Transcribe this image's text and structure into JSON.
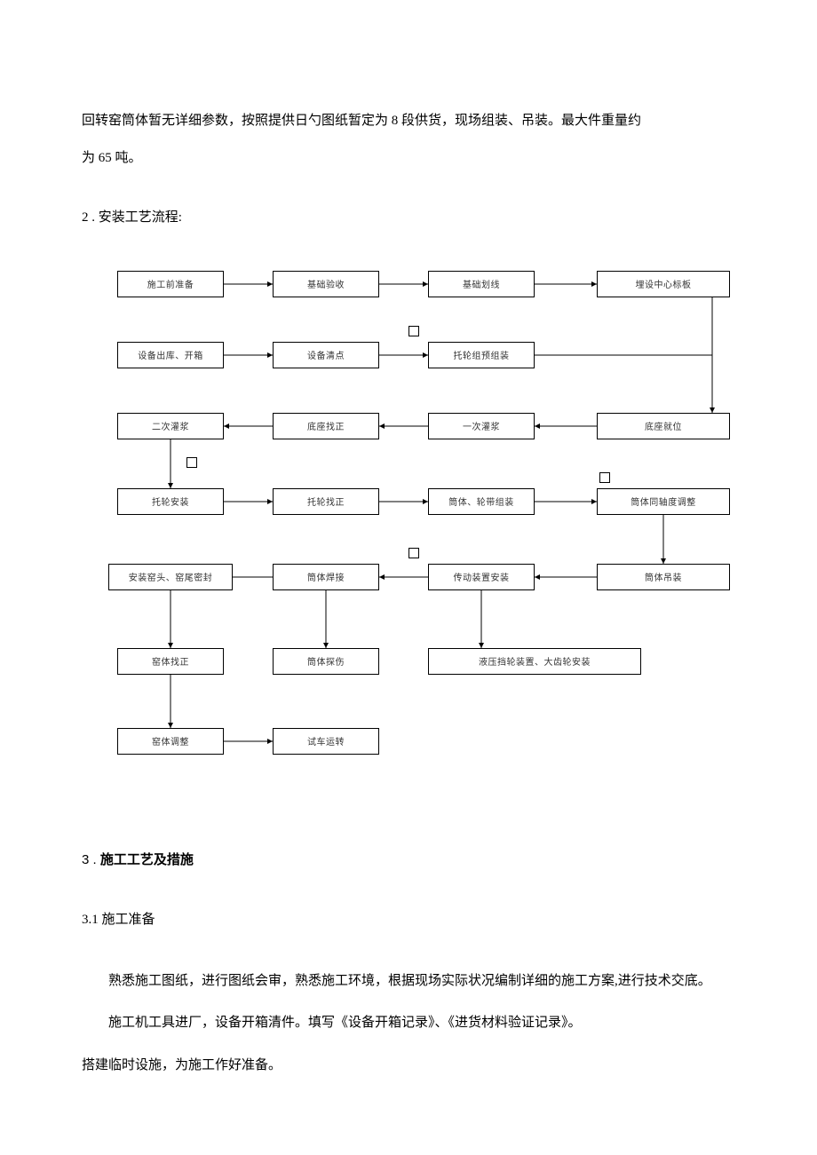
{
  "p1": "回转窑筒体暂无详细参数，按照提供日勺图纸暂定为 8 段供货，现场组装、吊装。最大件重量约",
  "p2": "为 65 吨。",
  "s2": "2 . 安装工艺流程:",
  "s3_prefix": "3 . ",
  "s3_title": "施工工艺及措施",
  "s31": "3.1 施工准备",
  "b1": "熟悉施工图纸，进行图纸会审，熟悉施工环境，根据现场实际状况编制详细的施工方案,进行技术交底。",
  "b2": "施工机工具进厂，设备开箱清件。填写《设备开箱记录》、《进货材料验证记录》。",
  "b3": "搭建临时设施，为施工作好准备。",
  "flow": {
    "r1": {
      "a": "施工前准备",
      "b": "基础验收",
      "c": "基础划线",
      "d": "埋设中心标板"
    },
    "r2": {
      "a": "设备出库、开箱",
      "b": "设备清点",
      "c": "托轮组预组装"
    },
    "r3": {
      "a": "二次灌浆",
      "b": "底座找正",
      "c": "一次灌浆",
      "d": "底座就位"
    },
    "r4": {
      "a": "托轮安装",
      "b": "托轮找正",
      "c": "筒体、轮带组装",
      "d": "筒体同轴度调整"
    },
    "r5": {
      "a": "安装窑头、窑尾密封",
      "b": "筒体焊接",
      "c": "传动装置安装",
      "d": "筒体吊装"
    },
    "r6": {
      "a": "窑体找正",
      "b": "筒体探伤",
      "c": "液压挡轮装置、大齿轮安装"
    },
    "r7": {
      "a": "窑体调整",
      "b": "试车运转"
    }
  }
}
